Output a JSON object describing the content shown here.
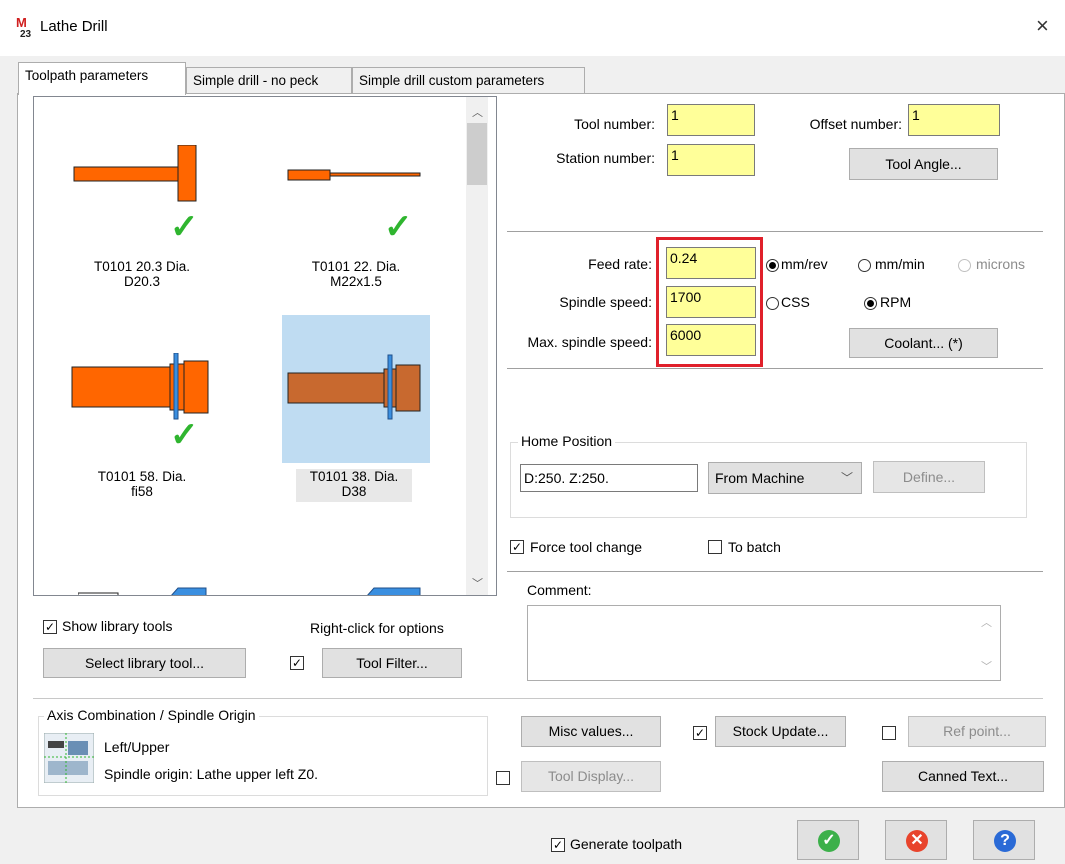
{
  "window": {
    "title": "Lathe Drill",
    "close_label": "×"
  },
  "tabs": [
    {
      "label": "Toolpath parameters"
    },
    {
      "label": "Simple drill - no peck"
    },
    {
      "label": "Simple drill custom parameters"
    }
  ],
  "tools": [
    {
      "line1": "T0101 20.3 Dia.",
      "line2": "D20.3",
      "checked": true
    },
    {
      "line1": "T0101 22. Dia.",
      "line2": "M22x1.5",
      "checked": true
    },
    {
      "line1": "T0101 58. Dia.",
      "line2": "fi58",
      "checked": true
    },
    {
      "line1": "T0101 38. Dia.",
      "line2": "D38",
      "selected": true
    }
  ],
  "tool_panel": {
    "show_library_label": "Show library tools",
    "right_click_label": "Right-click for options",
    "select_library_button": "Select library tool...",
    "tool_filter_button": "Tool Filter..."
  },
  "tool_fields": {
    "tool_number_label": "Tool number:",
    "tool_number": "1",
    "offset_number_label": "Offset number:",
    "offset_number": "1",
    "station_number_label": "Station number:",
    "station_number": "1",
    "tool_angle_button": "Tool Angle..."
  },
  "feeds": {
    "feed_rate_label": "Feed rate:",
    "feed_rate": "0.24",
    "spindle_speed_label": "Spindle speed:",
    "spindle_speed": "1700",
    "max_spindle_label": "Max. spindle speed:",
    "max_spindle": "6000",
    "mm_rev": "mm/rev",
    "mm_min": "mm/min",
    "microns": "microns",
    "css": "CSS",
    "rpm": "RPM",
    "coolant_button": "Coolant... (*)",
    "highlight_color": "#e0202a"
  },
  "home": {
    "title": "Home Position",
    "coords": "D:250.  Z:250.",
    "source": "From Machine",
    "define_button": "Define..."
  },
  "options": {
    "force_tool_change": "Force tool change",
    "to_batch": "To batch"
  },
  "comment": {
    "label": "Comment:",
    "value": ""
  },
  "axis": {
    "title": "Axis Combination / Spindle Origin",
    "position": "Left/Upper",
    "origin": "Spindle origin: Lathe upper left   Z0."
  },
  "actions": {
    "misc_values": "Misc values...",
    "stock_update": "Stock Update...",
    "ref_point": "Ref point...",
    "tool_display": "Tool Display...",
    "canned_text": "Canned Text..."
  },
  "footer": {
    "generate_toolpath": "Generate toolpath"
  },
  "colors": {
    "tool_orange": "#ff6600",
    "tool_selected": "#c8692f",
    "field_yellow": "#ffff99",
    "ok_green": "#3cb04a",
    "cancel_red": "#e8442c",
    "help_blue": "#2a6ad6"
  }
}
